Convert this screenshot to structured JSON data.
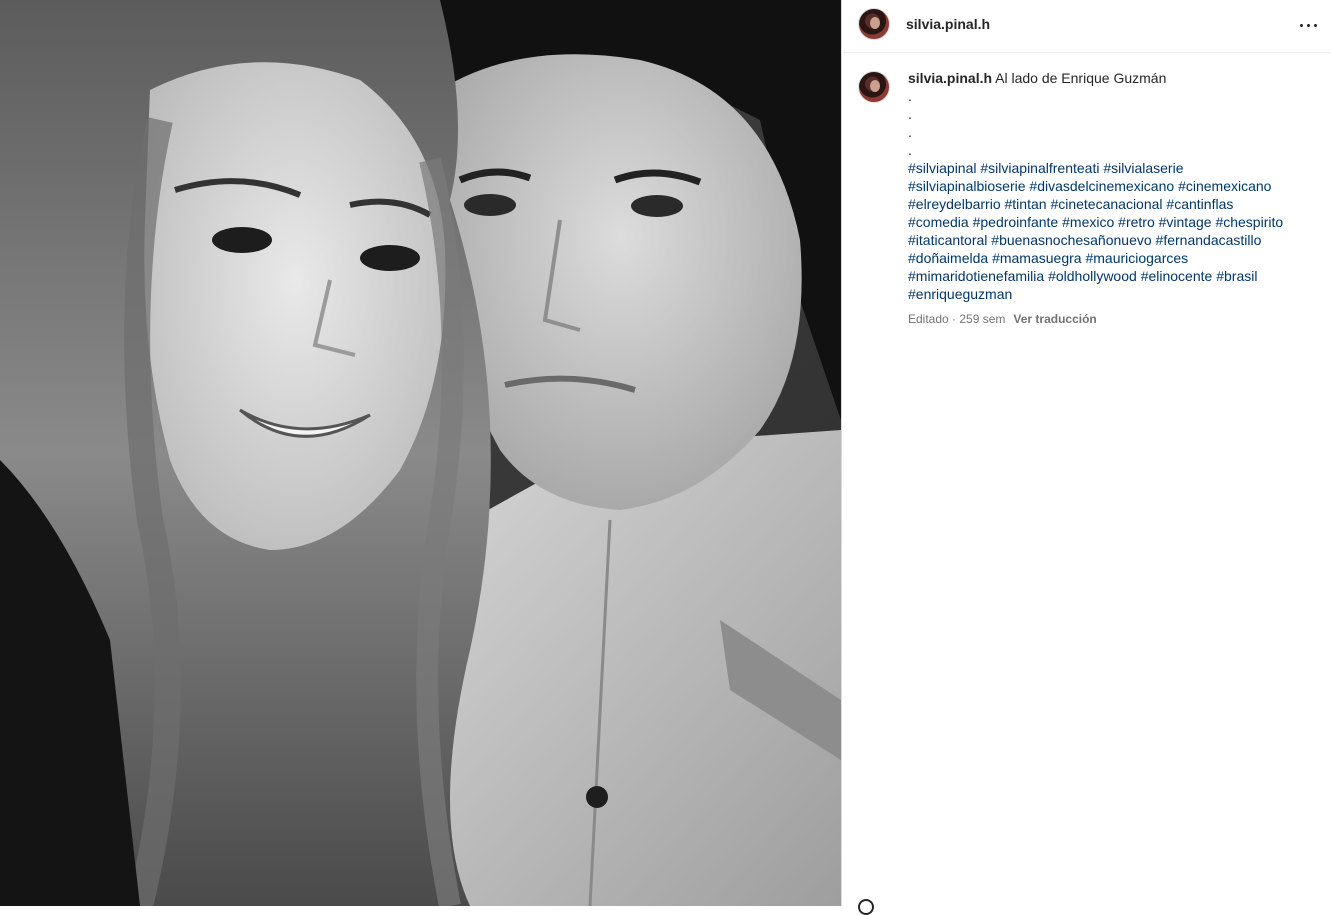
{
  "post": {
    "username": "silvia.pinal.h",
    "more_options_icon": "more-horizontal-icon",
    "media": {
      "description_icon": "photo",
      "style": "black-and-white portrait"
    },
    "caption": {
      "username": "silvia.pinal.h",
      "text": " Al lado de Enrique Guzmán",
      "dots": [
        ".",
        ".",
        ".",
        "."
      ],
      "hashtags": [
        "#silviapinal",
        "#silviapinalfrenteati",
        "#silvialaserie",
        "#silviapinalbioserie",
        "#divasdelcinemexicano",
        "#cinemexicano",
        "#elreydelbarrio",
        "#tintan",
        "#cinetecanacional",
        "#cantinflas",
        "#comedia",
        "#pedroinfante",
        "#mexico",
        "#retro",
        "#vintage",
        "#chespirito",
        "#itaticantoral",
        "#buenasnochesañonuevo",
        "#fernandacastillo",
        "#doñaimelda",
        "#mamasuegra",
        "#mauriciogarces",
        "#mimaridotienefamilia",
        "#oldhollywood",
        "#elinocente",
        "#brasil",
        "#enriqueguzman"
      ],
      "edited_time": "Editado · 259 sem",
      "translate_label": "Ver traducción"
    },
    "colors": {
      "hashtag": "#00376b",
      "text": "#262626",
      "secondary": "#737373",
      "divider": "#dbdbdb"
    }
  }
}
